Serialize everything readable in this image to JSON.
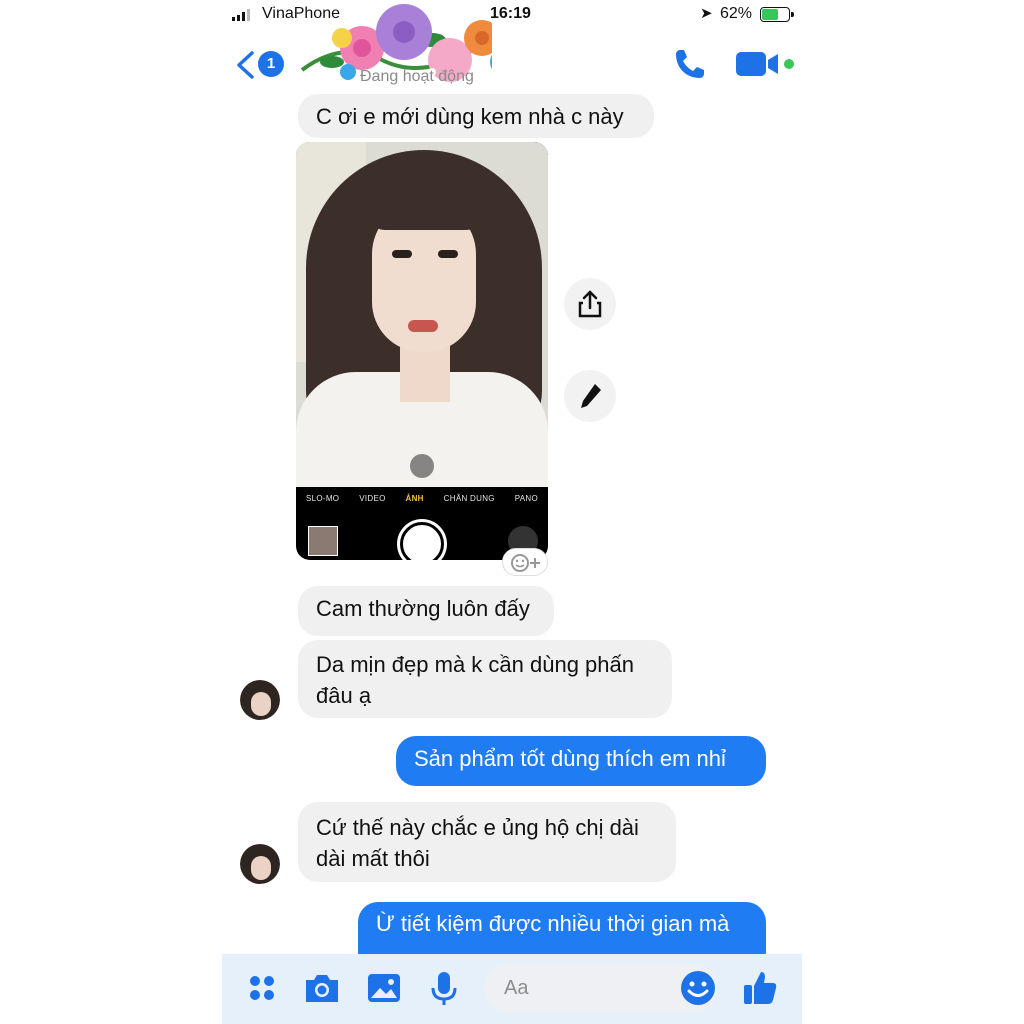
{
  "status_bar": {
    "carrier": "VinaPhone",
    "time": "16:19",
    "battery_percent": "62%",
    "battery_level": 0.62
  },
  "header": {
    "unread_badge": "1",
    "subtitle": "Đang hoạt động",
    "icons": [
      "back-chevron-icon",
      "phone-call-icon",
      "video-call-icon"
    ]
  },
  "messages": [
    {
      "direction": "in",
      "text": "C ơi e mới dùng kem nhà c này"
    },
    {
      "direction": "in",
      "type": "image",
      "camera_modes": [
        "SLO-MO",
        "VIDEO",
        "ẢNH",
        "CHÂN DUNG",
        "PANO"
      ],
      "active_mode": "ẢNH"
    },
    {
      "direction": "in",
      "text": "Cam thường luôn đấy"
    },
    {
      "direction": "in",
      "text": "Da mịn đẹp mà k cần dùng phấn đâu ạ"
    },
    {
      "direction": "out",
      "text": "Sản phẩm tốt dùng thích em nhỉ"
    },
    {
      "direction": "in",
      "text": "Cứ thế này chắc e ủng hộ chị dài dài mất thôi"
    },
    {
      "direction": "out",
      "text": "Ừ tiết kiệm được nhiều thời gian mà"
    }
  ],
  "composer": {
    "placeholder": "Aa",
    "icons": [
      "menu-dots-icon",
      "camera-icon",
      "gallery-icon",
      "microphone-icon",
      "emoji-icon",
      "thumbs-up-icon"
    ]
  },
  "colors": {
    "accent": "#1e72e8",
    "outgoing_bubble": "#1f7cf2",
    "incoming_bubble": "#f0f0f0",
    "online_dot": "#37c759"
  }
}
